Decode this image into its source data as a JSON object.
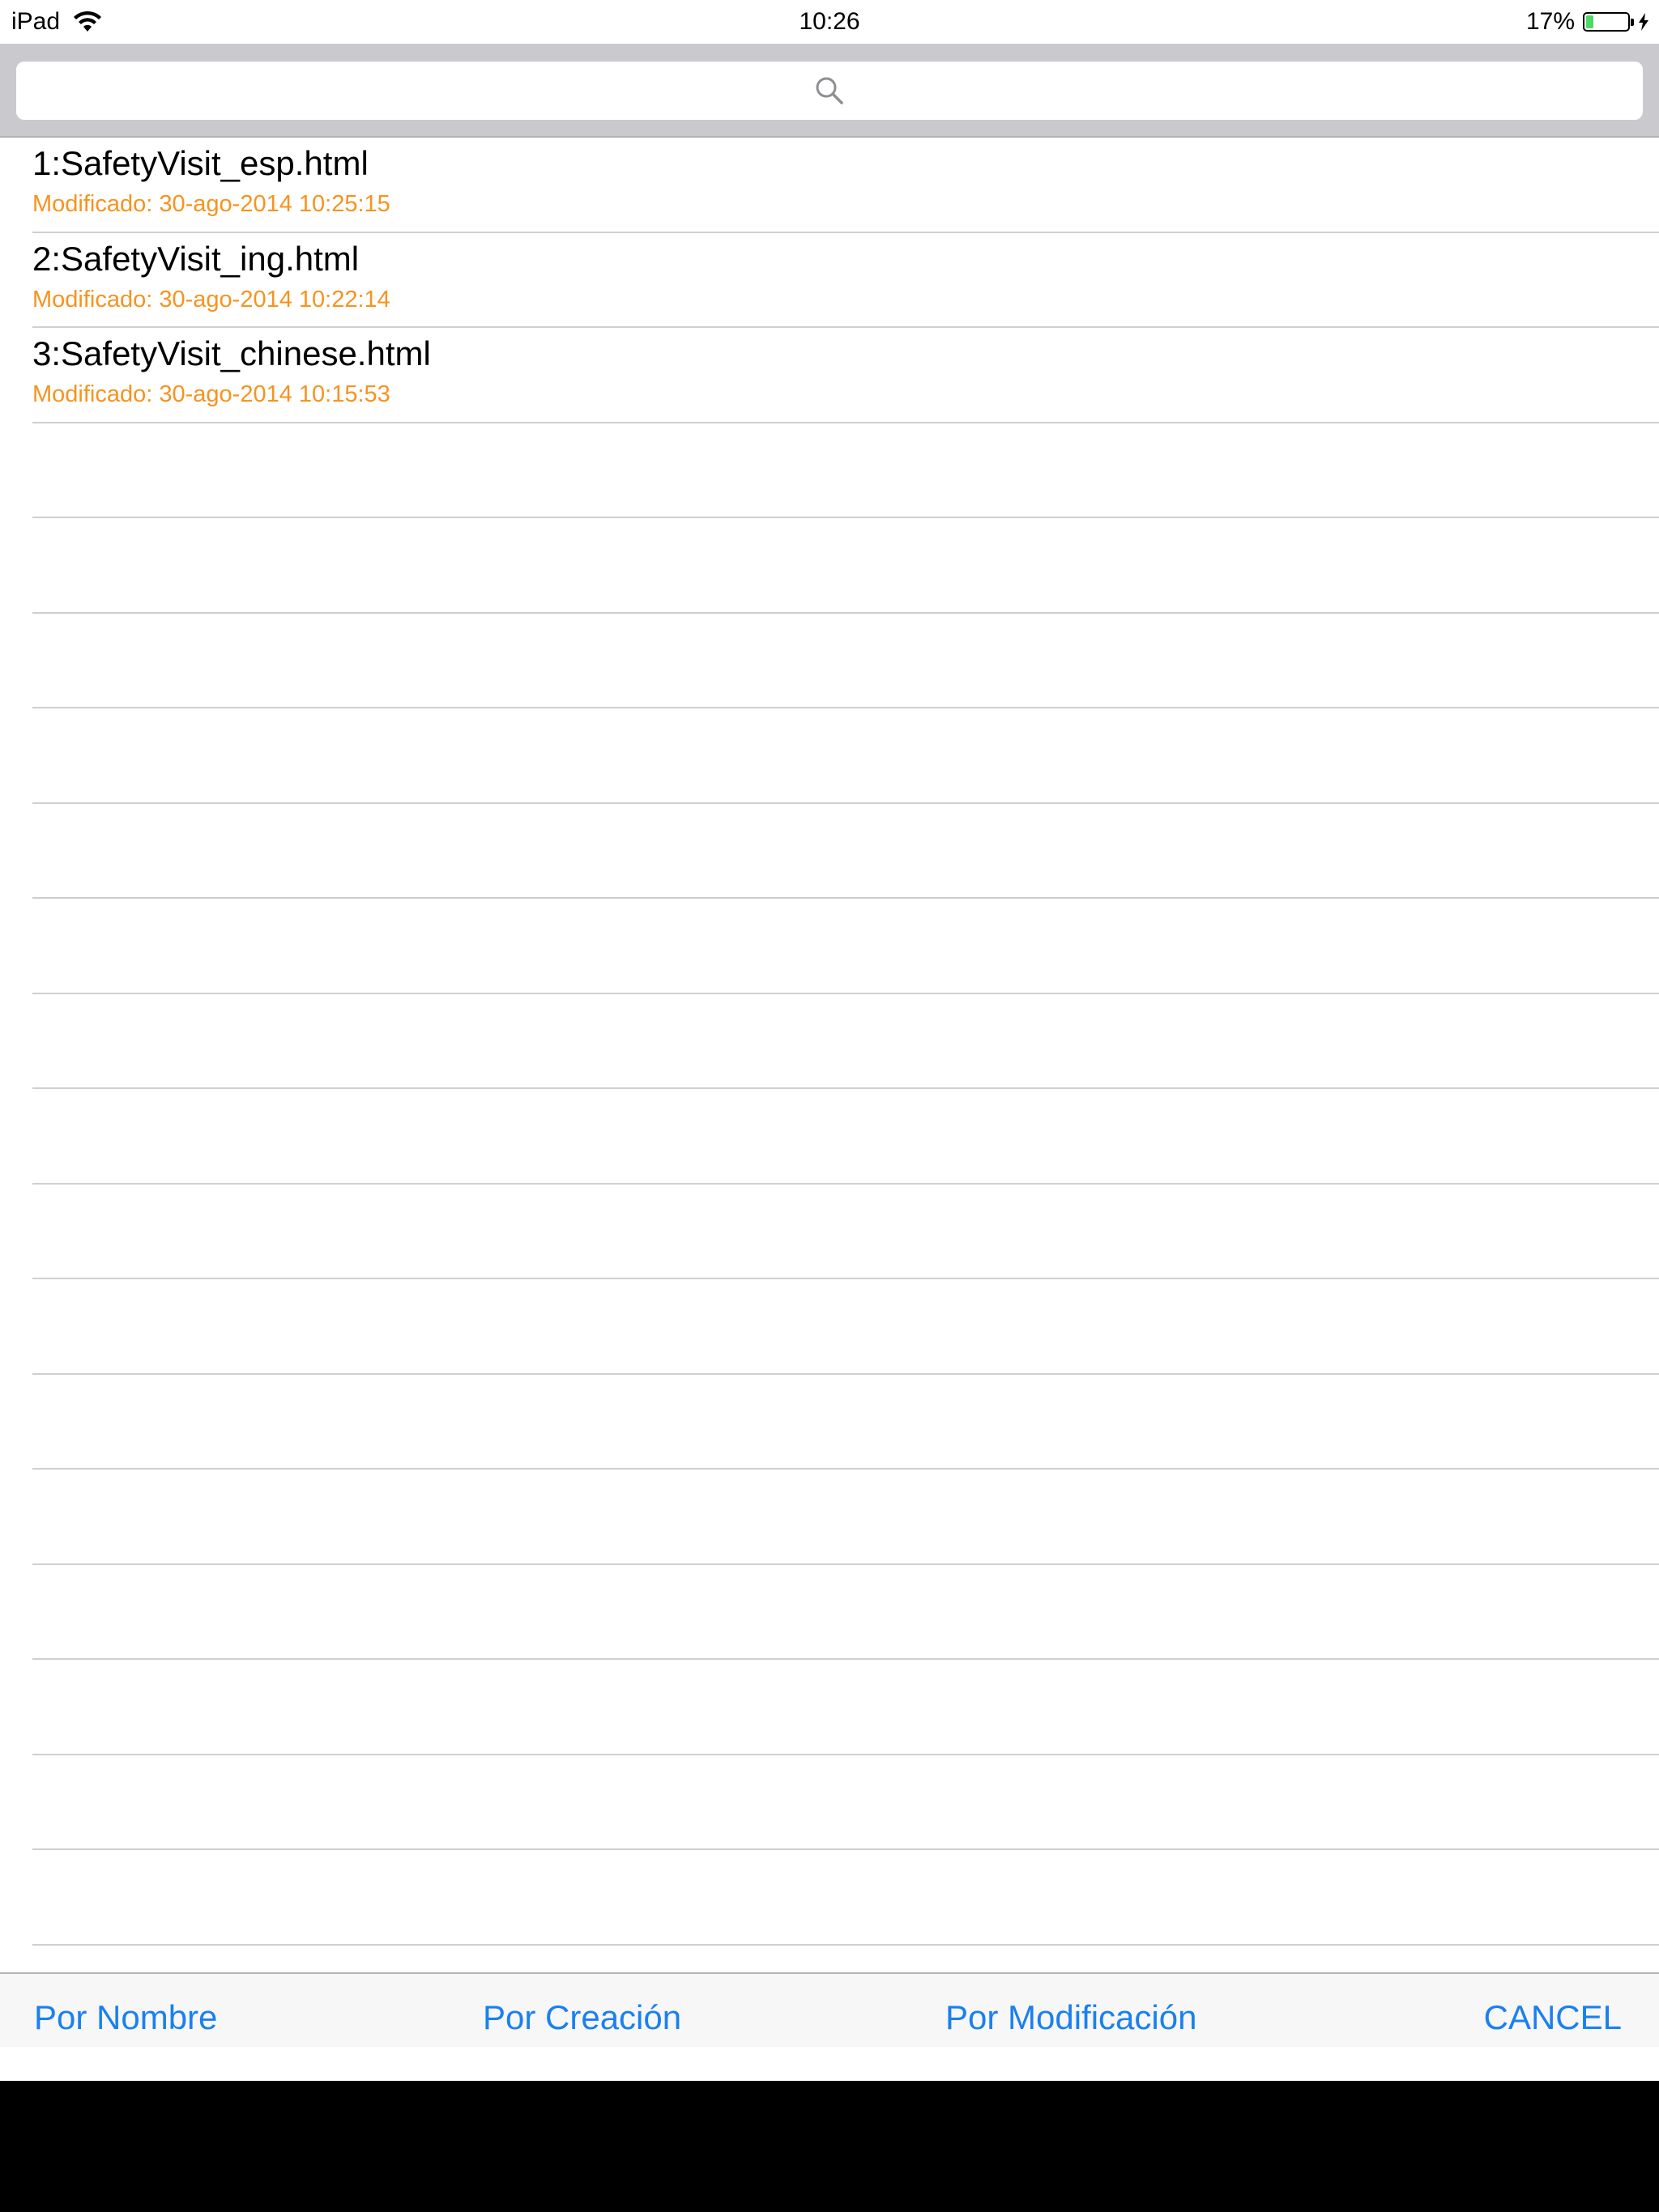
{
  "status_bar": {
    "device": "iPad",
    "time": "10:26",
    "battery_percent": "17%",
    "battery_level": 0.17
  },
  "search": {
    "placeholder": "",
    "value": ""
  },
  "files": [
    {
      "name": "1:SafetyVisit_esp.html",
      "modified": "Modificado: 30-ago-2014 10:25:15"
    },
    {
      "name": "2:SafetyVisit_ing.html",
      "modified": "Modificado: 30-ago-2014 10:22:14"
    },
    {
      "name": "3:SafetyVisit_chinese.html",
      "modified": "Modificado: 30-ago-2014 10:15:53"
    }
  ],
  "toolbar": {
    "by_name": "Por Nombre",
    "by_creation": "Por Creación",
    "by_modification": "Por Modificación",
    "cancel": "CANCEL"
  },
  "colors": {
    "accent": "#1a80f0",
    "subtitle": "#f7931e",
    "search_bar_bg": "#c9c9ce",
    "battery": "#4cd964"
  }
}
